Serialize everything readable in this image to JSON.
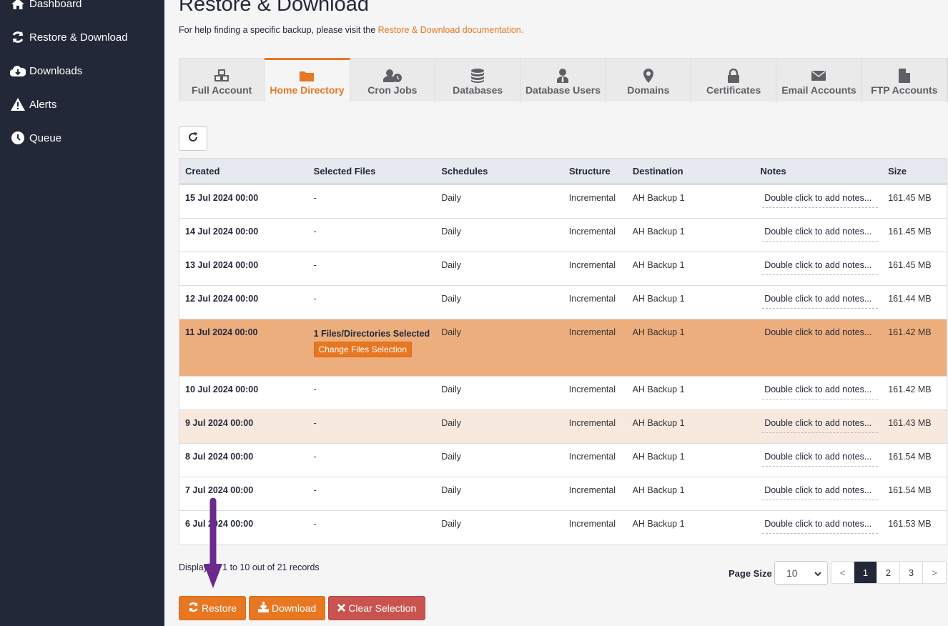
{
  "sidebar": {
    "items": [
      {
        "label": "Dashboard",
        "icon": "home-icon"
      },
      {
        "label": "Restore & Download",
        "icon": "sync-icon"
      },
      {
        "label": "Downloads",
        "icon": "cloud-download-icon"
      },
      {
        "label": "Alerts",
        "icon": "warning-icon"
      },
      {
        "label": "Queue",
        "icon": "clock-icon"
      }
    ]
  },
  "header": {
    "title": "Restore & Download",
    "help_text": "For help finding a specific backup, please visit the ",
    "help_link": "Restore & Download documentation."
  },
  "tabs": [
    {
      "label": "Full Account",
      "icon": "cubes-icon"
    },
    {
      "label": "Home Directory",
      "icon": "folder-icon",
      "active": true
    },
    {
      "label": "Cron Jobs",
      "icon": "user-clock-icon"
    },
    {
      "label": "Databases",
      "icon": "database-icon"
    },
    {
      "label": "Database Users",
      "icon": "user-tie-icon"
    },
    {
      "label": "Domains",
      "icon": "map-marker-icon"
    },
    {
      "label": "Certificates",
      "icon": "lock-icon"
    },
    {
      "label": "Email Accounts",
      "icon": "envelope-icon"
    },
    {
      "label": "FTP Accounts",
      "icon": "file-icon"
    }
  ],
  "table": {
    "columns": [
      "Created",
      "Selected Files",
      "Schedules",
      "Structure",
      "Destination",
      "Notes",
      "Size"
    ],
    "notes_placeholder": "Double click to add notes...",
    "change_files_label": "Change Files Selection",
    "rows": [
      {
        "created": "15 Jul 2024 00:00",
        "files": "-",
        "schedule": "Daily",
        "structure": "Incremental",
        "destination": "AH Backup 1",
        "size": "161.45 MB"
      },
      {
        "created": "14 Jul 2024 00:00",
        "files": "-",
        "schedule": "Daily",
        "structure": "Incremental",
        "destination": "AH Backup 1",
        "size": "161.45 MB"
      },
      {
        "created": "13 Jul 2024 00:00",
        "files": "-",
        "schedule": "Daily",
        "structure": "Incremental",
        "destination": "AH Backup 1",
        "size": "161.45 MB"
      },
      {
        "created": "12 Jul 2024 00:00",
        "files": "-",
        "schedule": "Daily",
        "structure": "Incremental",
        "destination": "AH Backup 1",
        "size": "161.44 MB"
      },
      {
        "created": "11 Jul 2024 00:00",
        "files": "1 Files/Directories Selected",
        "schedule": "Daily",
        "structure": "Incremental",
        "destination": "AH Backup 1",
        "size": "161.42 MB",
        "selected": true
      },
      {
        "created": "10 Jul 2024 00:00",
        "files": "-",
        "schedule": "Daily",
        "structure": "Incremental",
        "destination": "AH Backup 1",
        "size": "161.42 MB"
      },
      {
        "created": "9 Jul 2024 00:00",
        "files": "-",
        "schedule": "Daily",
        "structure": "Incremental",
        "destination": "AH Backup 1",
        "size": "161.43 MB",
        "hover": true
      },
      {
        "created": "8 Jul 2024 00:00",
        "files": "-",
        "schedule": "Daily",
        "structure": "Incremental",
        "destination": "AH Backup 1",
        "size": "161.54 MB"
      },
      {
        "created": "7 Jul 2024 00:00",
        "files": "-",
        "schedule": "Daily",
        "structure": "Incremental",
        "destination": "AH Backup 1",
        "size": "161.54 MB"
      },
      {
        "created": "6 Jul 2024 00:00",
        "files": "-",
        "schedule": "Daily",
        "structure": "Incremental",
        "destination": "AH Backup 1",
        "size": "161.53 MB"
      }
    ]
  },
  "footer": {
    "records_text": "Displaying 1 to 10 out of 21 records",
    "page_size_label": "Page Size",
    "page_size_value": "10",
    "pages": [
      "<",
      "1",
      "2",
      "3",
      ">"
    ],
    "current_page": "1"
  },
  "actions": {
    "restore": "Restore",
    "download": "Download",
    "clear": "Clear Selection"
  },
  "colors": {
    "accent": "#e87722",
    "sidebar_bg": "#232839",
    "selected_row": "#edae7e",
    "danger": "#c9534f",
    "annotation_arrow": "#6a2a8e"
  }
}
